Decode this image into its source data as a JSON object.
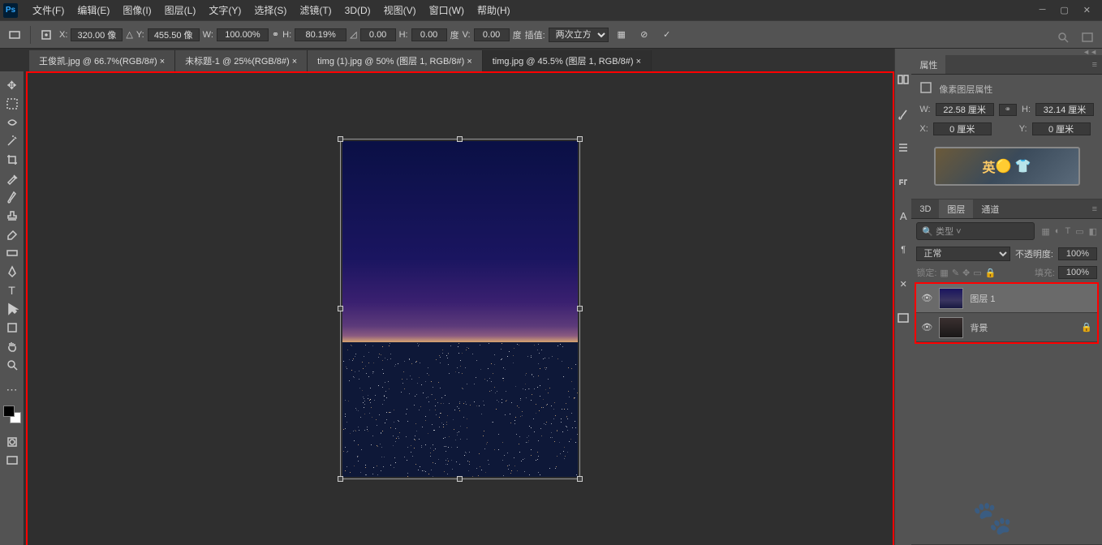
{
  "menu": [
    "文件(F)",
    "编辑(E)",
    "图像(I)",
    "图层(L)",
    "文字(Y)",
    "选择(S)",
    "滤镜(T)",
    "3D(D)",
    "视图(V)",
    "窗口(W)",
    "帮助(H)"
  ],
  "options": {
    "x_label": "X:",
    "x": "320.00 像",
    "y_label": "Y:",
    "y": "455.50 像",
    "w_label": "W:",
    "w": "100.00%",
    "h_label": "H:",
    "h": "80.19%",
    "ang": "0.00",
    "hsk_label": "H:",
    "hsk": "0.00",
    "hsk_unit": "度",
    "vsk_label": "V:",
    "vsk": "0.00",
    "vsk_unit": "度",
    "interp_label": "插值:",
    "interp": "两次立方"
  },
  "tabs": [
    {
      "label": "王俊凯.jpg @ 66.7%(RGB/8#) ×"
    },
    {
      "label": "未标题-1 @ 25%(RGB/8#) ×"
    },
    {
      "label": "timg (1).jpg @ 50% (图层 1, RGB/8#) ×"
    },
    {
      "label": "timg.jpg @ 45.5% (图层 1, RGB/8#) ×",
      "active": true
    }
  ],
  "properties": {
    "panel_title": "属性",
    "subtitle": "像素图层属性",
    "w_label": "W:",
    "w": "22.58 厘米",
    "h_label": "H:",
    "h": "32.14 厘米",
    "x_label": "X:",
    "x": "0 厘米",
    "y_label": "Y:",
    "y": "0 厘米"
  },
  "layers_panel": {
    "tabs": [
      "3D",
      "图层",
      "通道"
    ],
    "active_tab": "图层",
    "kind": "类型",
    "blend": "正常",
    "opacity_label": "不透明度:",
    "opacity": "100%",
    "lock_label": "锁定:",
    "fill_label": "填充:",
    "fill": "100%",
    "items": [
      {
        "name": "图层 1",
        "selected": true,
        "locked": false
      },
      {
        "name": "背景",
        "selected": false,
        "locked": true
      }
    ]
  },
  "ad_text": "英"
}
